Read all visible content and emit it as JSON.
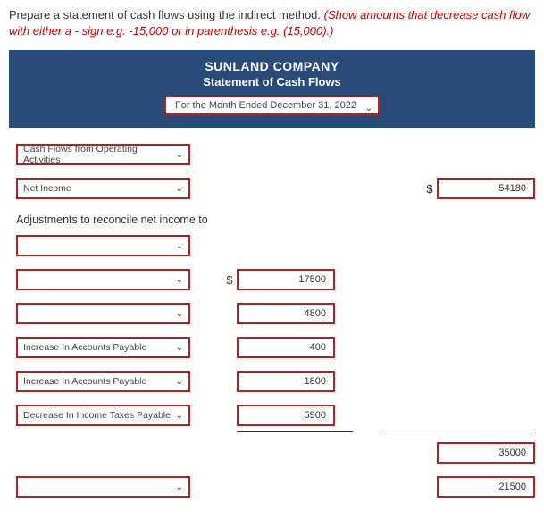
{
  "instructions": {
    "black": "Prepare a statement of cash flows using the indirect method. ",
    "red": "(Show amounts that decrease cash flow with either a - sign e.g. -15,000 or in parenthesis e.g. (15,000).)"
  },
  "header": {
    "company": "SUNLAND COMPANY",
    "title": "Statement of Cash Flows",
    "period": "For the Month Ended December 31, 2022"
  },
  "rows": {
    "r1_label": "Cash Flows from Operating Activities",
    "r2_label": "Net Income",
    "r2_value": "54180",
    "adjustments_label": "Adjustments to reconcile net income to",
    "r3_label": "",
    "r4_label": "",
    "r4_value": "17500",
    "r5_label": "",
    "r5_value": "4800",
    "r6_label": "Increase In Accounts Payable",
    "r6_value": "400",
    "r7_label": "Increase In Accounts Payable",
    "r7_value": "1800",
    "r8_label": "Decrease In Income Taxes Payable",
    "r8_value": "5900",
    "r9_value": "35000",
    "r10_label": "",
    "r10_value": "21500"
  }
}
